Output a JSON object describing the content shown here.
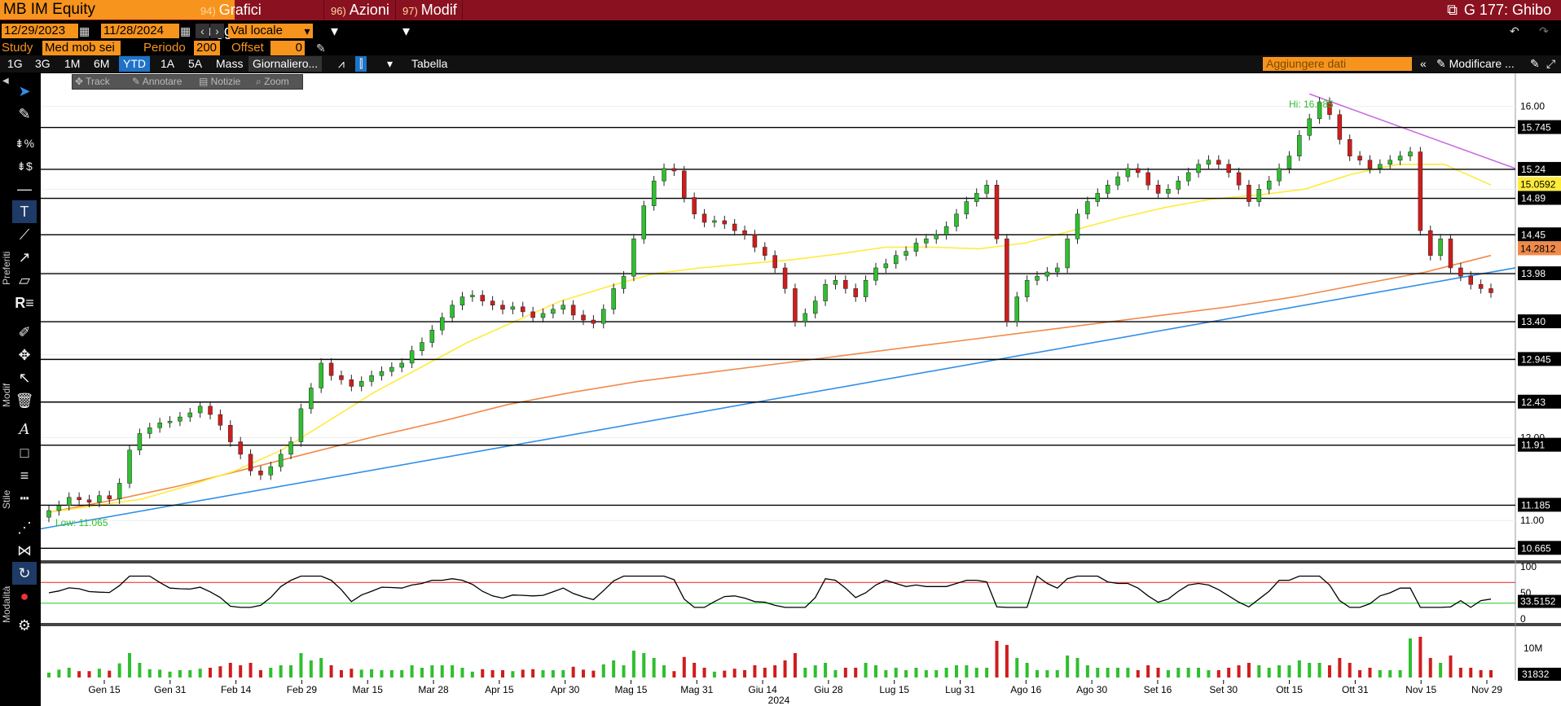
{
  "security": "MB IM Equity",
  "menus": [
    {
      "num": "94)",
      "label": "Grafici suggeriti"
    },
    {
      "num": "96)",
      "label": "Azioni"
    },
    {
      "num": "97)",
      "label": "Modif"
    }
  ],
  "window_title": "G 177: Ghibo",
  "date_from": "12/29/2023",
  "date_to": "11/28/2024",
  "currency": "Val locale",
  "study_label": "Study",
  "study_value": "Med mob sei",
  "period_label": "Periodo",
  "period_value": "200",
  "offset_label": "Offset",
  "offset_value": "0",
  "ranges": [
    "1G",
    "3G",
    "1M",
    "6M",
    "YTD",
    "1A",
    "5A",
    "Mass"
  ],
  "selected_range": "YTD",
  "frequency": "Giornaliero...",
  "table_label": "Tabella",
  "add_data_placeholder": "Aggiungere dati",
  "modify_label": "Modificare ...",
  "subtools": [
    "Track",
    "Annotare",
    "Notizie",
    "Zoom"
  ],
  "toolbar_sections": [
    "Preferiti",
    "Modif",
    "Stile",
    "Modalità"
  ],
  "icons": [
    "cursor-icon",
    "pencil-icon",
    "fib-percent-icon",
    "fib-dollar-icon",
    "horizontal-line-icon",
    "text-tool-icon",
    "trendline-icon",
    "ray-icon",
    "channel-icon",
    "regression-icon",
    "pen-icon",
    "move-icon",
    "select-icon",
    "trash-icon",
    "font-icon",
    "fill-icon",
    "line-width-icon",
    "line-style-icon",
    "dotted-icon",
    "magnet-icon",
    "reload-icon",
    "color-icon",
    "settings-icon"
  ],
  "colors": {
    "up": "#2fbf2f",
    "down": "#d01c1c",
    "ma50": "#ffeb3b",
    "ma200": "#f08a4b",
    "trend_up": "#2f8fe8",
    "trend_down": "#c86be0",
    "accent": "#f7941d",
    "brand": "#8a1220"
  },
  "chart_data": {
    "type": "candlestick",
    "x_ticks": [
      "Gen 15",
      "Gen 31",
      "Feb 14",
      "Feb 29",
      "Mar 15",
      "Mar 28",
      "Apr 15",
      "Apr 30",
      "Mag 15",
      "Mag 31",
      "Giu 14",
      "Giu 28",
      "Lug 15",
      "Lug 31",
      "Ago 16",
      "Ago 30",
      "Set 16",
      "Set 30",
      "Ott 15",
      "Ott 31",
      "Nov 15",
      "Nov 29"
    ],
    "year_label": "2024",
    "y_ticks": [
      "16.00",
      "12.00",
      "11.00"
    ],
    "y_range": [
      10.55,
      16.35
    ],
    "price_levels": [
      "15.745",
      "15.24",
      "14.89",
      "14.45",
      "13.98",
      "13.40",
      "12.945",
      "12.43",
      "11.91",
      "11.185",
      "10.665"
    ],
    "last_price": "13.98",
    "ma50_label": "15.0592",
    "ma200_label": "14.2812",
    "hi_label": "Hi: 16.185",
    "lo_label": "Low: 11.065",
    "close_series": [
      11.12,
      11.18,
      11.28,
      11.25,
      11.22,
      11.3,
      11.26,
      11.45,
      11.85,
      12.05,
      12.12,
      12.18,
      12.2,
      12.25,
      12.3,
      12.38,
      12.28,
      12.15,
      11.95,
      11.8,
      11.6,
      11.55,
      11.65,
      11.8,
      11.95,
      12.35,
      12.6,
      12.9,
      12.75,
      12.7,
      12.62,
      12.68,
      12.75,
      12.8,
      12.85,
      12.9,
      13.05,
      13.15,
      13.3,
      13.45,
      13.6,
      13.7,
      13.72,
      13.65,
      13.6,
      13.55,
      13.58,
      13.52,
      13.45,
      13.5,
      13.55,
      13.6,
      13.48,
      13.42,
      13.38,
      13.55,
      13.8,
      13.95,
      14.4,
      14.8,
      15.1,
      15.25,
      15.22,
      14.9,
      14.7,
      14.6,
      14.62,
      14.58,
      14.5,
      14.45,
      14.3,
      14.2,
      14.05,
      13.8,
      13.4,
      13.5,
      13.65,
      13.85,
      13.9,
      13.8,
      13.7,
      13.9,
      14.05,
      14.1,
      14.2,
      14.25,
      14.35,
      14.4,
      14.45,
      14.55,
      14.7,
      14.85,
      14.95,
      15.05,
      14.4,
      13.4,
      13.7,
      13.9,
      13.95,
      14.0,
      14.05,
      14.4,
      14.7,
      14.85,
      14.95,
      15.05,
      15.15,
      15.25,
      15.2,
      15.05,
      14.95,
      15.0,
      15.1,
      15.2,
      15.3,
      15.35,
      15.3,
      15.2,
      15.05,
      14.85,
      15.0,
      15.1,
      15.25,
      15.4,
      15.65,
      15.85,
      16.05,
      15.9,
      15.6,
      15.4,
      15.35,
      15.25,
      15.3,
      15.35,
      15.4,
      15.45,
      14.5,
      14.2,
      14.4,
      14.05,
      13.95,
      13.85,
      13.8,
      13.75
    ],
    "open_series_offset": 0.08,
    "ma50_series": [
      11.1,
      11.18,
      11.26,
      11.42,
      11.6,
      11.85,
      12.2,
      12.55,
      12.85,
      13.15,
      13.4,
      13.65,
      13.82,
      13.98,
      14.05,
      14.1,
      14.15,
      14.22,
      14.3,
      14.3,
      14.28,
      14.35,
      14.5,
      14.65,
      14.78,
      14.88,
      14.93,
      15.0,
      15.18,
      15.3,
      15.3,
      15.05
    ],
    "ma200_series": [
      11.1,
      11.25,
      11.42,
      11.62,
      11.82,
      12.02,
      12.2,
      12.4,
      12.55,
      12.68,
      12.78,
      12.88,
      12.98,
      13.08,
      13.18,
      13.28,
      13.38,
      13.48,
      13.58,
      13.7,
      13.85,
      14.0,
      14.2
    ],
    "rsi_range": [
      0,
      100
    ],
    "rsi_ticks": [
      "100",
      "50",
      "0"
    ],
    "rsi_last": "33.5152",
    "rsi_overbought": 70,
    "rsi_oversold": 30,
    "volume_tick": "10M",
    "volume_last": "31832"
  }
}
